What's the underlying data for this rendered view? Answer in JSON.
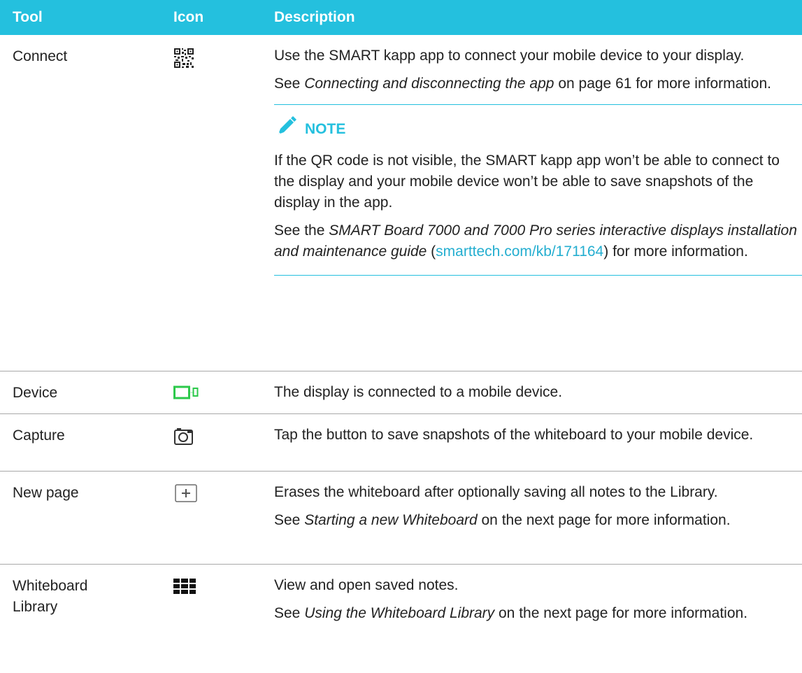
{
  "header": {
    "tool": "Tool",
    "icon": "Icon",
    "description": "Description"
  },
  "colors": {
    "accent": "#24c0de",
    "device_icon_green": "#2cc94b",
    "link": "#24aed0"
  },
  "rows": [
    {
      "tool": "Connect",
      "icon": "qr-code-icon",
      "desc_1": "Use the SMART kapp app to connect your mobile device to your display.",
      "see_1_pre": "See ",
      "see_1_em": "Connecting and disconnecting the app",
      "see_1_post": " on page 61 for more information.",
      "note_label": "NOTE",
      "note_text": "If the QR code is not visible, the SMART kapp app won’t be able to connect to the display and your mobile device won’t be able to save snapshots of the display in the app.",
      "note_see_pre": "See the ",
      "note_see_em": "SMART Board 7000 and 7000 Pro series interactive displays installation and maintenance guide",
      "note_link_open": " (",
      "note_link": "smarttech.com/kb/171164",
      "note_see_post": ") for more information."
    },
    {
      "tool": "Device",
      "icon": "device-connected-icon",
      "desc_1": "The display is connected to a mobile device."
    },
    {
      "tool": "Capture",
      "icon": "camera-icon",
      "desc_1": "Tap the button to save snapshots of the whiteboard to your mobile device."
    },
    {
      "tool": "New page",
      "icon": "new-page-plus-icon",
      "desc_1": "Erases the whiteboard after optionally saving all notes to the Library.",
      "see_1_pre": "See ",
      "see_1_em": "Starting a new Whiteboard",
      "see_1_post": " on the next page for more information."
    },
    {
      "tool_line1": "Whiteboard",
      "tool_line2": "Library",
      "icon": "grid-library-icon",
      "desc_1": "View and open saved notes.",
      "see_1_pre": "See ",
      "see_1_em": "Using the Whiteboard Library",
      "see_1_post": " on the next page for more information."
    }
  ]
}
